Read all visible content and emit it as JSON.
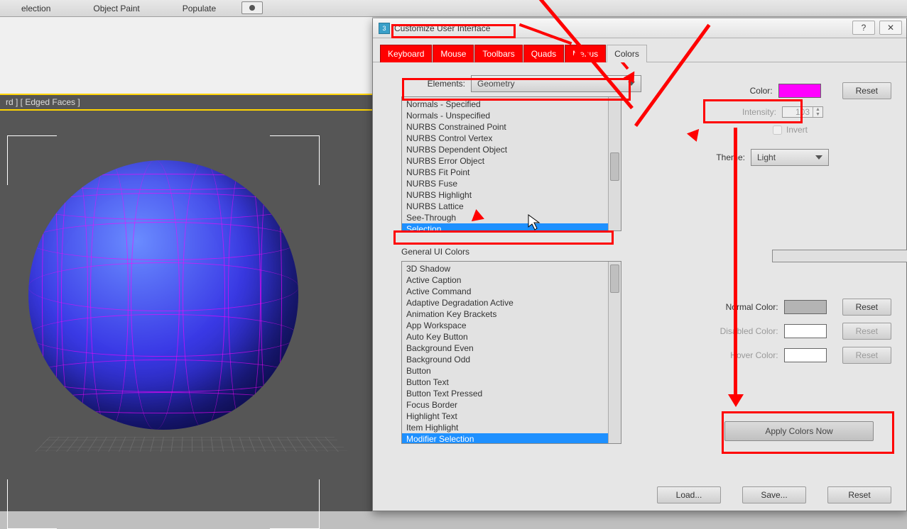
{
  "topbar": {
    "selection": "election",
    "objpaint": "Object Paint",
    "populate": "Populate"
  },
  "strip_label": "rd ] [ Edged Faces ]",
  "dialog": {
    "title": "Customize User Interface",
    "tabs": [
      "Keyboard",
      "Mouse",
      "Toolbars",
      "Quads",
      "Menus",
      "Colors"
    ],
    "elements_label": "Elements:",
    "elements_value": "Geometry",
    "list1": [
      "Normals - Specified",
      "Normals - Unspecified",
      "NURBS Constrained Point",
      "NURBS Control Vertex",
      "NURBS Dependent Object",
      "NURBS Error Object",
      "NURBS Fit Point",
      "NURBS Fuse",
      "NURBS Highlight",
      "NURBS Lattice",
      "See-Through",
      "Selection"
    ],
    "list1_selected": 11,
    "general_label": "General UI Colors",
    "list2": [
      "3D Shadow",
      "Active Caption",
      "Active Command",
      "Adaptive Degradation Active",
      "Animation Key Brackets",
      "App Workspace",
      "Auto Key Button",
      "Background Even",
      "Background Odd",
      "Button",
      "Button Text",
      "Button Text Pressed",
      "Focus Border",
      "Highlight Text",
      "Item Highlight",
      "Modifier Selection"
    ],
    "list2_selected": 15,
    "color_label": "Color:",
    "reset": "Reset",
    "intensity_label": "Intensity:",
    "intensity_value": "103",
    "invert": "Invert",
    "theme_label": "Theme:",
    "theme_value": "Light",
    "normal": "Normal Color:",
    "disabled": "Disabled Color:",
    "hover": "Hover Color:",
    "apply": "Apply Colors Now",
    "load": "Load...",
    "save": "Save..."
  }
}
